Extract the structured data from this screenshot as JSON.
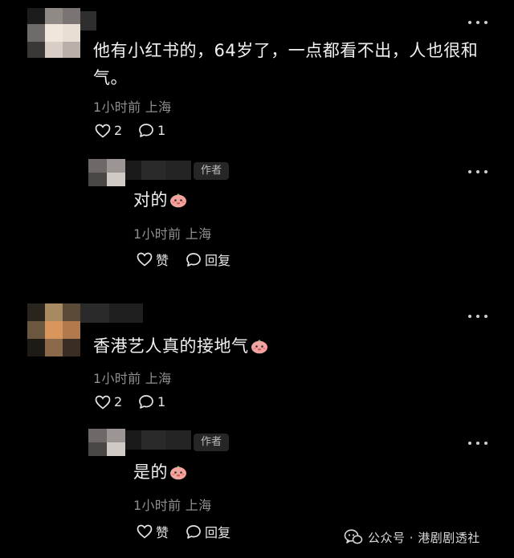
{
  "comments": [
    {
      "text": "他有小红书的，64岁了，一点都看不出，人也很和",
      "text_line2": "气。",
      "meta": "1小时前 上海",
      "likes": "2",
      "replies": "1",
      "reply": {
        "badge": "作者",
        "text": "对的",
        "meta": "1小时前 上海",
        "like_label": "赞",
        "reply_label": "回复"
      }
    },
    {
      "text": "香港艺人真的接地气",
      "meta": "1小时前 上海",
      "likes": "2",
      "replies": "1",
      "reply": {
        "badge": "作者",
        "text": "是的",
        "meta": "1小时前 上海",
        "like_label": "赞",
        "reply_label": "回复"
      }
    }
  ],
  "watermark": {
    "text": "公众号 · 港剧剧透社",
    "icon": "wechat-official-account-icon"
  },
  "colors": {
    "background": "#000000",
    "text": "#f2f2f2",
    "meta": "#8f8f8f",
    "badge_bg": "#262626"
  }
}
